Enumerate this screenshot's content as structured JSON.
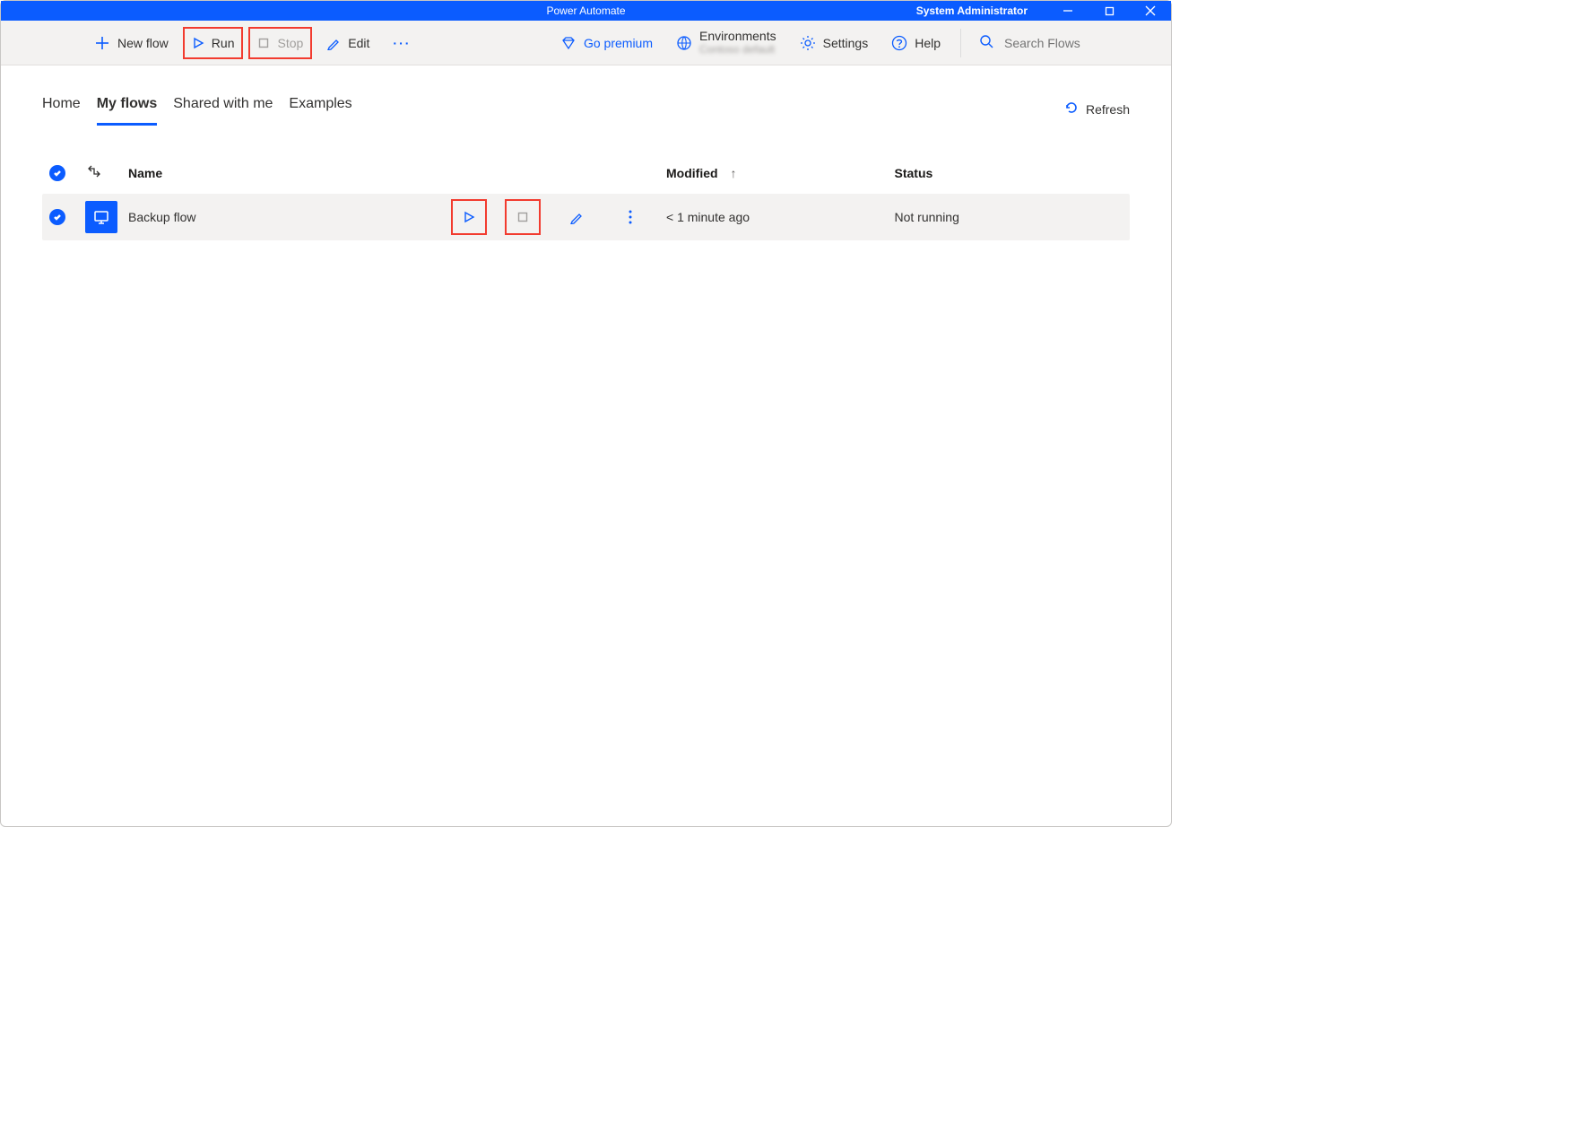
{
  "titlebar": {
    "title": "Power Automate",
    "user": "System Administrator"
  },
  "cmdbar": {
    "newFlow": "New flow",
    "run": "Run",
    "stop": "Stop",
    "edit": "Edit",
    "goPremium": "Go premium",
    "environments": "Environments",
    "settings": "Settings",
    "help": "Help",
    "searchPlaceholder": "Search Flows"
  },
  "tabs": {
    "home": "Home",
    "myFlows": "My flows",
    "shared": "Shared with me",
    "examples": "Examples"
  },
  "refresh": "Refresh",
  "columns": {
    "name": "Name",
    "modified": "Modified",
    "status": "Status"
  },
  "rows": [
    {
      "name": "Backup flow",
      "modified": "< 1 minute ago",
      "status": "Not running"
    }
  ]
}
